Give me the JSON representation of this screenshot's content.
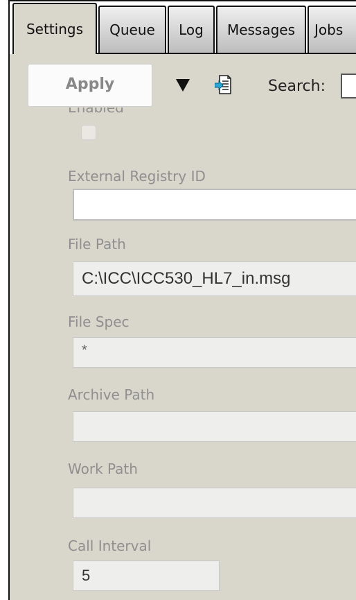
{
  "tabs": [
    {
      "label": "Settings",
      "active": true
    },
    {
      "label": "Queue",
      "active": false
    },
    {
      "label": "Log",
      "active": false
    },
    {
      "label": "Messages",
      "active": false
    },
    {
      "label": "Jobs",
      "active": false
    }
  ],
  "toolbar": {
    "apply_label": "Apply",
    "dropdown_icon": "triangle-down-icon",
    "export_icon": "document-export-icon",
    "search_label": "Search:",
    "search_value": ""
  },
  "form": {
    "enabled_label": "Enabled",
    "enabled_checked": false,
    "external_registry_label": "External Registry ID",
    "external_registry_value": "",
    "file_path_label": "File Path",
    "file_path_value": "C:\\ICC\\ICC530_HL7_in.msg",
    "file_spec_label": "File Spec",
    "file_spec_value": "*",
    "archive_path_label": "Archive Path",
    "archive_path_value": "",
    "work_path_label": "Work Path",
    "work_path_value": "",
    "call_interval_label": "Call Interval",
    "call_interval_value": "5"
  },
  "colors": {
    "panel_bg": "#d9d7cc",
    "label_grey": "#8f8f8f",
    "tab_border": "#111111"
  }
}
